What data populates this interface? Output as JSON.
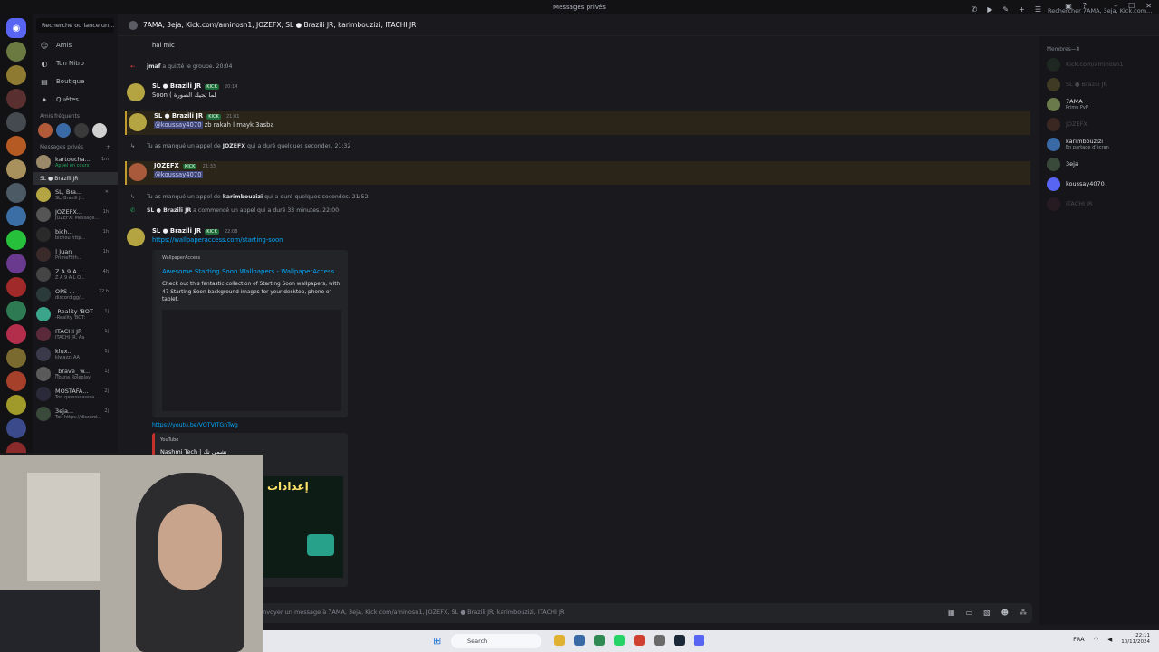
{
  "window": {
    "title": "Messages privés"
  },
  "dm_sidebar": {
    "search_placeholder": "Recherche ou lance un...",
    "nav": [
      {
        "label": "Amis",
        "icon": "friends-icon"
      },
      {
        "label": "Ton Nitro",
        "icon": "nitro-icon"
      },
      {
        "label": "Boutique",
        "icon": "shop-icon"
      },
      {
        "label": "Quêtes",
        "icon": "quests-icon"
      }
    ],
    "frequent_label": "Amis fréquents",
    "dm_section_label": "Messages privés",
    "dms": [
      {
        "name": "kartoucha...",
        "sub": "Appel en cours",
        "time": "1m"
      },
      {
        "name": "SL ● Brazili JR",
        "sub": "",
        "time": "",
        "pinned": true
      },
      {
        "name": "SL, Bra...",
        "sub": "SL, Brazili J...",
        "time": "",
        "active": true
      },
      {
        "name": "JOZEFX...",
        "sub": "JOZEFX: Message...",
        "time": "1h"
      },
      {
        "name": "bich...",
        "sub": "bichou http...",
        "time": "1h"
      },
      {
        "name": "| Juan",
        "sub": "PrimeFilth...",
        "time": "1h"
      },
      {
        "name": "Z A 9 A...",
        "sub": "Z A 9 A L O...",
        "time": "4h"
      },
      {
        "name": "OPS ...",
        "sub": "discord.gg/...",
        "time": "22 h"
      },
      {
        "name": "-Reality 'BOT",
        "sub": "-Reality 'BOT:",
        "time": "1j"
      },
      {
        "name": "ITACHI JR",
        "sub": "ITACHI JR: Aa",
        "time": "1j"
      },
      {
        "name": "klux...",
        "sub": "klwazz: AA",
        "time": "1j"
      },
      {
        "name": "_brave_ w...",
        "sub": "iTouna Roleplay",
        "time": "1j"
      },
      {
        "name": "MOSTAFA...",
        "sub": "Ton qasssssasssa...",
        "time": "2j"
      },
      {
        "name": "3eja...",
        "sub": "Toi: https://discord...",
        "time": "2j"
      }
    ]
  },
  "chat_header": {
    "title": "7AMA, 3eja, Kick.com/aminosn1, JOZEFX, SL ● Brazili JR, karimbouzizi, ITACHI JR",
    "search_placeholder": "Rechercher 7AMA, 3eja, Kick.com..."
  },
  "messages": [
    {
      "kind": "text",
      "body": "hal mic"
    },
    {
      "kind": "system",
      "icon": "leave-arrow-icon",
      "actor": "jmaf",
      "text": "a quitté le groupe.",
      "time": "20:04"
    },
    {
      "kind": "message",
      "author": "SL ● Brazili JR",
      "badge": "KICK",
      "time": "20:14",
      "body": "Soon ( لما تجيك الصورة"
    },
    {
      "kind": "message",
      "author": "SL ● Brazili JR",
      "badge": "KICK",
      "time": "21:01",
      "mention": "@koussay4070",
      "body": "zb rakah l mayk 3asba",
      "highlight": true
    },
    {
      "kind": "system",
      "icon": "missed-call-icon",
      "prefix": "Tu as manqué un appel de",
      "actor": "JOZEFX",
      "text": "qui a duré quelques secondes.",
      "time": "21:32"
    },
    {
      "kind": "message",
      "author": "JOZEFX",
      "badge": "KICK",
      "time": "21:33",
      "mention": "@koussay4070",
      "body": "",
      "highlight": true
    },
    {
      "kind": "system",
      "icon": "missed-call-icon",
      "prefix": "Tu as manqué un appel de",
      "actor": "karimbouzizi",
      "text": "qui a duré quelques secondes.",
      "time": "21:52"
    },
    {
      "kind": "system",
      "icon": "call-icon",
      "prefix": "",
      "actor": "SL ● Brazili JR",
      "text": "a commencé un appel qui a duré 33 minutes.",
      "time": "22:00"
    },
    {
      "kind": "message",
      "author": "SL ● Brazili JR",
      "badge": "KICK",
      "time": "22:08",
      "link": "https://wallpaperaccess.com/starting-soon"
    }
  ],
  "embed": {
    "provider": "WallpaperAccess",
    "title": "Awesome Starting Soon Wallpapers - WallpaperAccess",
    "description": "Check out this fantastic collection of Starting Soon wallpapers, with 47 Starting Soon background images for your desktop, phone or tablet."
  },
  "youtube": {
    "link": "https://youtu.be/VQTVITGnTwg",
    "provider": "YouTube",
    "channel": "Nashmi Tech | نشمي تك",
    "thumb_text": "إعدادات"
  },
  "composer": {
    "placeholder": "Envoyer un message à 7AMA, 3eja, Kick.com/aminosn1, JOZEFX, SL ● Brazili JR, karimbouzizi, ITACHI JR"
  },
  "members": {
    "header": "Membres—8",
    "list": [
      {
        "name": "Kick.com/aminosn1",
        "sub": "",
        "online": false
      },
      {
        "name": "SL ● Brazili JR",
        "sub": "",
        "online": false
      },
      {
        "name": "7AMA",
        "sub": "Prime PvP",
        "online": true
      },
      {
        "name": "JOZEFX",
        "sub": "",
        "online": false
      },
      {
        "name": "karimbouzizi",
        "sub": "En partage d'écran",
        "online": true
      },
      {
        "name": "3eja",
        "sub": "",
        "online": true
      },
      {
        "name": "koussay4070",
        "sub": "",
        "online": true
      },
      {
        "name": "ITACHI JR",
        "sub": "",
        "online": false
      }
    ]
  },
  "taskbar": {
    "search_label": "Search",
    "lang": "FRA",
    "time": "22:11",
    "date": "10/11/2024"
  },
  "colors": {
    "accent": "#5865f2",
    "link": "#00a8fc",
    "kick": "#1e6b3a",
    "highlight_bar": "#c29b2e"
  }
}
